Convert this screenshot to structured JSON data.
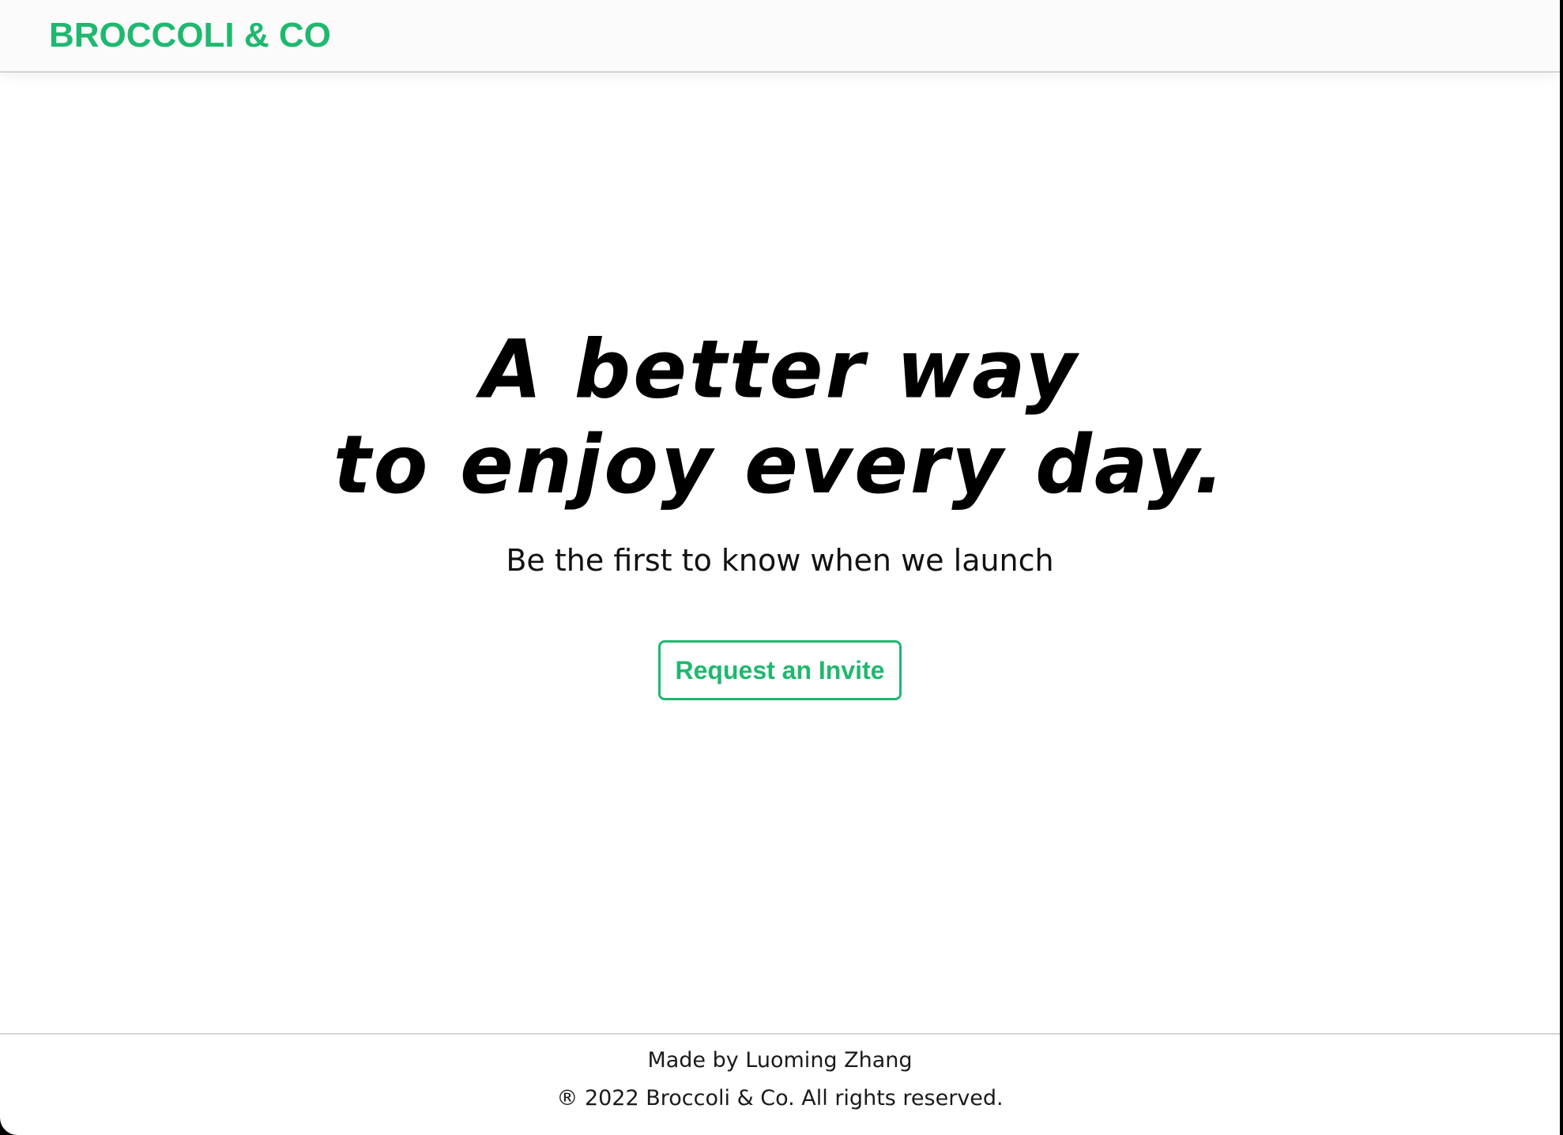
{
  "header": {
    "logo": "BROCCOLI & CO"
  },
  "hero": {
    "headline_line1": "A better way",
    "headline_line2": "to enjoy every day.",
    "subtitle": "Be the first to know when we launch",
    "cta_label": "Request an Invite"
  },
  "footer": {
    "credit": "Made by Luoming Zhang",
    "copyright": "® 2022 Broccoli & Co. All rights reserved."
  },
  "colors": {
    "brand": "#1fb86f",
    "text": "#000000",
    "background": "#ffffff"
  }
}
